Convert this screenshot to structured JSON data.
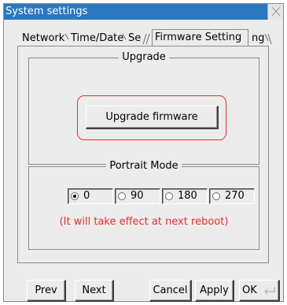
{
  "window": {
    "title": "System settings",
    "colors": {
      "titlebar": "#2a78c0",
      "highlight": "#e03030",
      "note": "#e23030",
      "panel": "#ececec"
    }
  },
  "tabs": [
    {
      "label": "Network",
      "active": false
    },
    {
      "label": "Time/Date",
      "active": false
    },
    {
      "label": "Se",
      "active": false
    },
    {
      "label": "Firmware Setting",
      "active": true
    },
    {
      "label": "ng",
      "active": false
    }
  ],
  "upgrade": {
    "title": "Upgrade",
    "button_label": "Upgrade firmware"
  },
  "portrait": {
    "title": "Portrait Mode",
    "options": [
      {
        "label": "0",
        "checked": true
      },
      {
        "label": "90",
        "checked": false
      },
      {
        "label": "180",
        "checked": false
      },
      {
        "label": "270",
        "checked": false
      }
    ],
    "note": "(It will take effect at next reboot)"
  },
  "footer": {
    "prev_label": "Prev",
    "next_label": "Next",
    "cancel_label": "Cancel",
    "apply_label": "Apply",
    "ok_label": "OK",
    "ok_icon": "enter-arrow-icon"
  }
}
